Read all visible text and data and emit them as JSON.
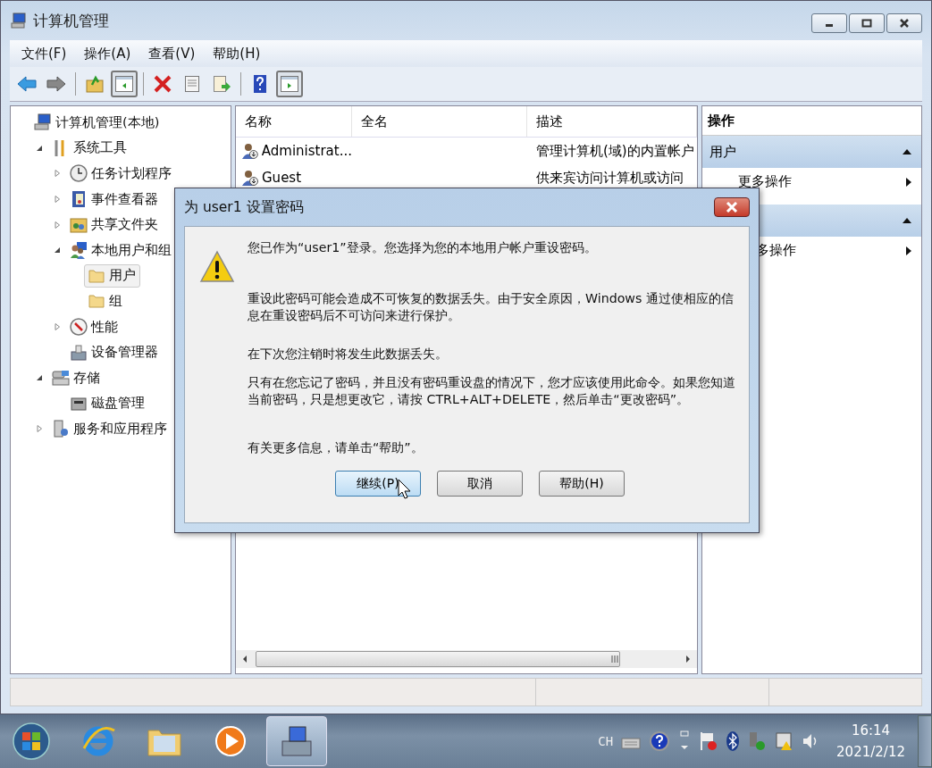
{
  "window": {
    "title": "计算机管理"
  },
  "menu": [
    "文件(F)",
    "操作(A)",
    "查看(V)",
    "帮助(H)"
  ],
  "toolbar": [
    {
      "kind": "back",
      "pressed": false
    },
    {
      "kind": "forward",
      "pressed": false
    },
    {
      "kind": "separator"
    },
    {
      "kind": "up",
      "pressed": false
    },
    {
      "kind": "tree-pane",
      "pressed": true
    },
    {
      "kind": "separator"
    },
    {
      "kind": "delete",
      "pressed": false
    },
    {
      "kind": "properties",
      "pressed": false
    },
    {
      "kind": "export",
      "pressed": false
    },
    {
      "kind": "separator"
    },
    {
      "kind": "help",
      "pressed": false
    },
    {
      "kind": "action-pane",
      "pressed": true
    }
  ],
  "tree": [
    {
      "label": "计算机管理(本地)",
      "kind": "computer",
      "selected": false,
      "children": [
        {
          "label": "系统工具",
          "kind": "tools",
          "expanded": true,
          "selected": false,
          "children": [
            {
              "label": "任务计划程序",
              "kind": "clock",
              "expanded": false,
              "selected": false
            },
            {
              "label": "事件查看器",
              "kind": "log",
              "expanded": false,
              "selected": false
            },
            {
              "label": "共享文件夹",
              "kind": "share",
              "expanded": false,
              "selected": false
            },
            {
              "label": "本地用户和组",
              "kind": "users",
              "expanded": true,
              "selected": false,
              "children": [
                {
                  "label": "用户",
                  "kind": "folder",
                  "selected": true
                },
                {
                  "label": "组",
                  "kind": "folder",
                  "selected": false
                }
              ]
            },
            {
              "label": "性能",
              "kind": "gauge",
              "expanded": false,
              "selected": false
            },
            {
              "label": "设备管理器",
              "kind": "device",
              "selected": false
            }
          ]
        },
        {
          "label": "存储",
          "kind": "storage",
          "expanded": true,
          "selected": false,
          "children": [
            {
              "label": "磁盘管理",
              "kind": "disk",
              "selected": false
            }
          ]
        },
        {
          "label": "服务和应用程序",
          "kind": "services",
          "expanded": false,
          "selected": false
        }
      ]
    }
  ],
  "list": {
    "columns": [
      "名称",
      "全名",
      "描述"
    ],
    "rows": [
      {
        "name": "Administrat...",
        "description": "管理计算机(域)的内置帐户",
        "selected": false
      },
      {
        "name": "Guest",
        "description": "供来宾访问计算机或访问",
        "selected": false
      }
    ]
  },
  "actions": {
    "title": "操作",
    "sections": [
      {
        "title": "用户",
        "items": [
          "更多操作"
        ]
      },
      {
        "items": [
          "多操作"
        ]
      }
    ]
  },
  "dialog": {
    "title": "为 user1 设置密码",
    "paragraphs": [
      "您已作为“user1”登录。您选择为您的本地用户帐户重设密码。",
      "重设此密码可能会造成不可恢复的数据丢失。由于安全原因，Windows 通过使相应的信息在重设密码后不可访问来进行保护。",
      "在下次您注销时将发生此数据丢失。",
      "只有在您忘记了密码，并且没有密码重设盘的情况下，您才应该使用此命令。如果您知道当前密码，只是想更改它，请按 CTRL+ALT+DELETE，然后单击“更改密码”。",
      "有关更多信息，请单击“帮助”。"
    ],
    "buttons": [
      {
        "label": "继续(P)",
        "default": true
      },
      {
        "label": "取消",
        "default": false
      },
      {
        "label": "帮助(H)",
        "default": false
      }
    ]
  },
  "taskbar": {
    "apps": [
      {
        "kind": "browser",
        "active": false
      },
      {
        "kind": "explorer",
        "active": false
      },
      {
        "kind": "media",
        "active": false
      },
      {
        "kind": "computer-management",
        "active": true
      }
    ],
    "tray": {
      "language": "CH",
      "time": "16:14",
      "date": "2021/2/12"
    }
  }
}
